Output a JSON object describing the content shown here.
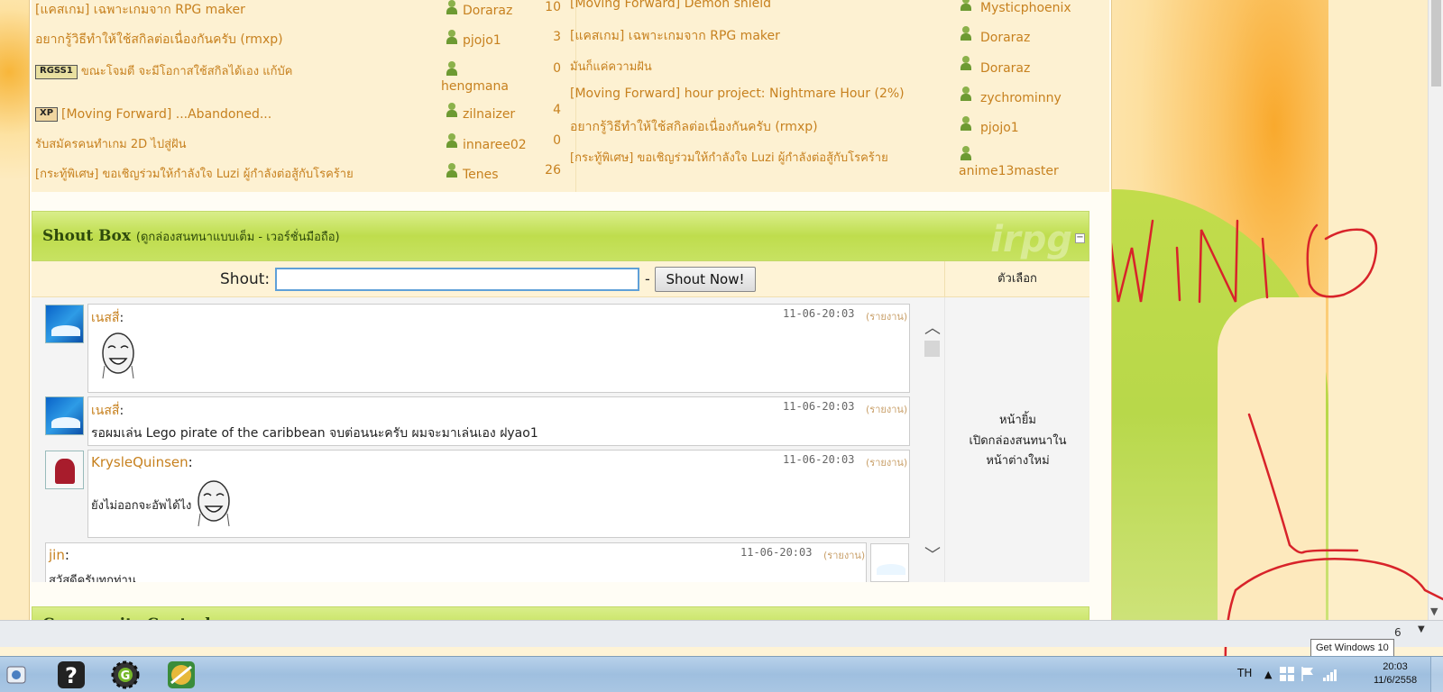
{
  "topics_left": [
    {
      "title": "[แคสเกม] เฉพาะเกมจาก RPG maker",
      "user": "Doraraz",
      "count": "10",
      "badge": ""
    },
    {
      "title": "อยากรู้วิธีทำให้ใช้สกิลต่อเนื่องกันครับ (rmxp)",
      "user": "pjojo1",
      "count": "3",
      "badge": ""
    },
    {
      "title": "ขณะโจมตี จะมีโอกาสใช้สกิลได้เอง แก้บัค",
      "user": "hengmana",
      "count": "0",
      "badge": "RGSS1"
    },
    {
      "title": "[Moving Forward] ...Abandoned...",
      "user": "zilnaizer",
      "count": "4",
      "badge": "XP"
    },
    {
      "title": "รับสมัครคนทำเกม 2D ไปสู่ฝัน",
      "user": "innaree02",
      "count": "0",
      "badge": ""
    },
    {
      "title": "[กระทู้พิเศษ] ขอเชิญร่วมให้กำลังใจ Luzi ผู้กำลังต่อสู้กับโรคร้าย",
      "user": "Tenes",
      "count": "26",
      "badge": ""
    }
  ],
  "topics_right": [
    {
      "title": "[Moving Forward] Demon shield",
      "user": "Mysticphoenix"
    },
    {
      "title": "[แคสเกม] เฉพาะเกมจาก RPG maker",
      "user": "Doraraz"
    },
    {
      "title": "มันก็แค่ความฝัน",
      "user": "Doraraz"
    },
    {
      "title": "[Moving Forward] hour project: Nightmare Hour (2%)",
      "user": "zychrominny"
    },
    {
      "title": "อยากรู้วิธีทำให้ใช้สกิลต่อเนื่องกันครับ (rmxp)",
      "user": "pjojo1"
    },
    {
      "title": "[กระทู้พิเศษ] ขอเชิญร่วมให้กำลังใจ Luzi ผู้กำลังต่อสู้กับโรคร้าย",
      "user": "anime13master"
    }
  ],
  "shoutbox": {
    "title": "Shout Box",
    "subtitle": "(ดูกล่องสนทนาแบบเต็ม - เวอร์ชั่นมือถือ)",
    "watermark": "irpg",
    "collapse": "−",
    "shout_label": "Shout:",
    "input_value": "",
    "dash": "-",
    "button_label": "Shout Now!",
    "options_title": "ตัวเลือก",
    "options": [
      "หน้ายิ้ม",
      "เปิดกล่องสนทนาใน",
      "หน้าต่างใหม่"
    ],
    "messages": [
      {
        "name": "เนสสี่",
        "time": "11-06-20:03",
        "report": "(รายงาน)",
        "text": ""
      },
      {
        "name": "เนสสี่",
        "time": "11-06-20:03",
        "report": "(รายงาน)",
        "text": "รอผมเล่น Lego pirate of the caribbean จบต่อนนะครับ ผมจะมาเล่นเอง ฝyao1"
      },
      {
        "name": "KrysleQuinsen",
        "time": "11-06-20:03",
        "report": "(รายงาน)",
        "text": "ยังไม่ออกจะอัพได้ไง"
      },
      {
        "name": "jin",
        "time": "11-06-20:03",
        "report": "(รายงาน)",
        "text": "สวัสดีครับทุกท่าน"
      }
    ]
  },
  "community": {
    "title": "Community Central"
  },
  "tooltip": "Get Windows 10",
  "taskbar": {
    "lang": "TH",
    "time": "20:03",
    "date": "11/6/2558",
    "tray_partial": "6"
  }
}
